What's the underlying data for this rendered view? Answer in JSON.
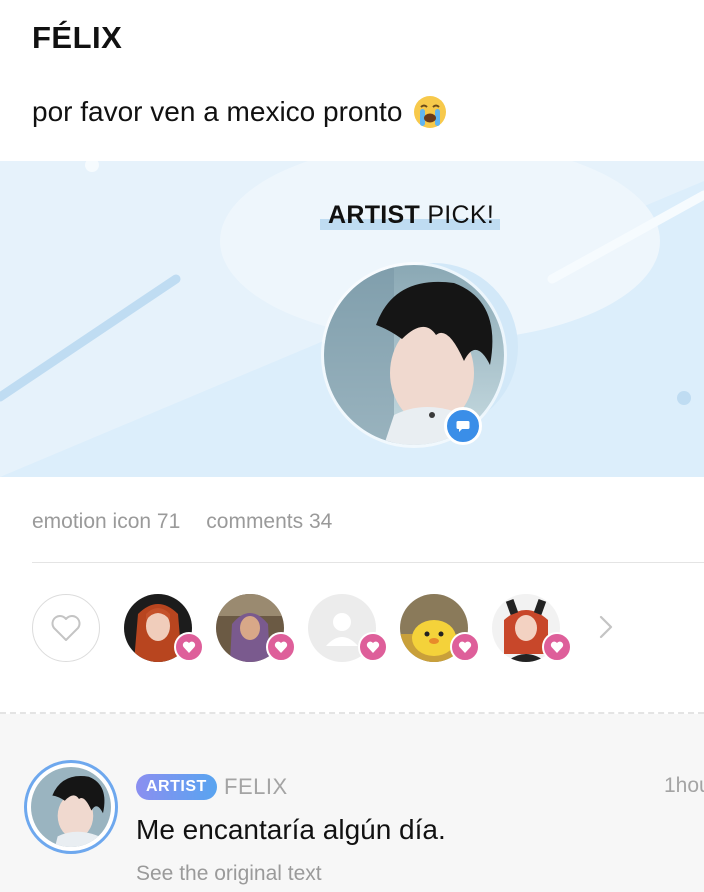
{
  "post": {
    "title": "FÉLIX",
    "body": "por favor ven a mexico pronto",
    "emoji": "crying-face"
  },
  "banner": {
    "label_bold": "ARTIST",
    "label_rest": " PICK!",
    "badge_icon": "chat-bubble-icon"
  },
  "stats": {
    "emotion_label": "emotion icon 71",
    "comments_label": "comments 34"
  },
  "likers": {
    "like_icon": "heart-outline-icon",
    "count_shown": 5,
    "more_icon": "chevron-right-icon"
  },
  "comment": {
    "tag": "ARTIST",
    "author": "FELIX",
    "time": "1hou",
    "text": "Me encantaría algún día.",
    "translate": "See the original text"
  },
  "colors": {
    "accent_blue": "#3a8ee8",
    "heart_pink": "#de5f9a",
    "banner_bg": "#e6f2fb",
    "muted_text": "#9a9a9a"
  }
}
